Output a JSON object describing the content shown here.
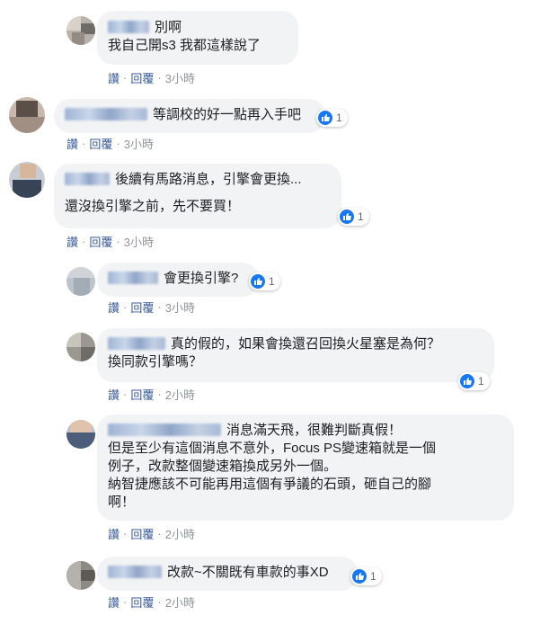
{
  "comments": [
    {
      "id": "c1",
      "lines": [
        "別啊",
        "我自己開s3 我都這樣說了"
      ],
      "reactions": null,
      "actions": {
        "like": "讚",
        "reply": "回覆",
        "time": "3小時"
      }
    },
    {
      "id": "c2",
      "lines": [
        "等調校的好一點再入手吧"
      ],
      "reactions": "1",
      "actions": {
        "like": "讚",
        "reply": "回覆",
        "time": "3小時"
      }
    },
    {
      "id": "c3",
      "lines": [
        "後續有馬路消息，引擎會更換...",
        "",
        "還沒換引擎之前，先不要買！"
      ],
      "reactions": "1",
      "actions": {
        "like": "讚",
        "reply": "回覆",
        "time": "3小時"
      }
    },
    {
      "id": "c4",
      "lines": [
        "會更換引擎?"
      ],
      "reactions": "1",
      "actions": {
        "like": "讚",
        "reply": "回覆",
        "time": "3小時"
      }
    },
    {
      "id": "c5",
      "lines": [
        "真的假的，如果會換還召回換火星塞是為何？",
        "換同款引擎嗎？"
      ],
      "reactions": "1",
      "actions": {
        "like": "讚",
        "reply": "回覆",
        "time": "2小時"
      }
    },
    {
      "id": "c6",
      "lines": [
        "消息滿天飛，很難判斷真假！",
        "但是至少有這個消息不意外，Focus PS變速箱就是一個",
        "例子，改款整個變速箱換成另外一個。",
        "納智捷應該不可能再用這個有爭議的石頭，砸自己的腳",
        "啊！"
      ],
      "reactions": null,
      "actions": {
        "like": "讚",
        "reply": "回覆",
        "time": "2小時"
      }
    },
    {
      "id": "c7",
      "lines": [
        "改款~不關既有車款的事XD"
      ],
      "reactions": "1",
      "actions": {
        "like": "讚",
        "reply": "回覆",
        "time": "2小時"
      }
    }
  ],
  "colors": {
    "bubble": "#f2f3f5",
    "link": "#385898",
    "meta": "#90949c",
    "like": "#1877f2"
  },
  "icons": {
    "reaction": "like-thumb-icon"
  }
}
